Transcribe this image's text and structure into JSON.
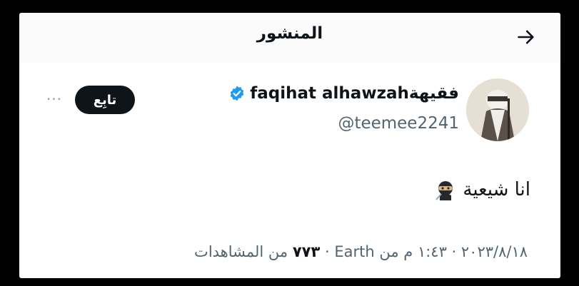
{
  "header": {
    "title": "المنشور"
  },
  "icons": {
    "back": "arrow-right-icon",
    "verified": "verified-badge-icon",
    "more": "more-dots-icon",
    "emoji": "ninja-emoji-icon"
  },
  "colors": {
    "verified": "#1d9bf0",
    "follow_bg": "#0f1419",
    "secondary_text": "#536471"
  },
  "author": {
    "display_name": "faqihat alhawzahفقيهة",
    "handle": "@teemee2241"
  },
  "actions": {
    "follow_label": "تابِع",
    "more_label": "···"
  },
  "tweet": {
    "text": "انا شيعية"
  },
  "meta": {
    "date": "٢٠٢٣/٨/١٨",
    "sep1": " · ",
    "time": "١:٤٣ م من Earth",
    "sep2": " · ",
    "views_count": "٧٧٣",
    "views_label": "من المشاهدات"
  }
}
